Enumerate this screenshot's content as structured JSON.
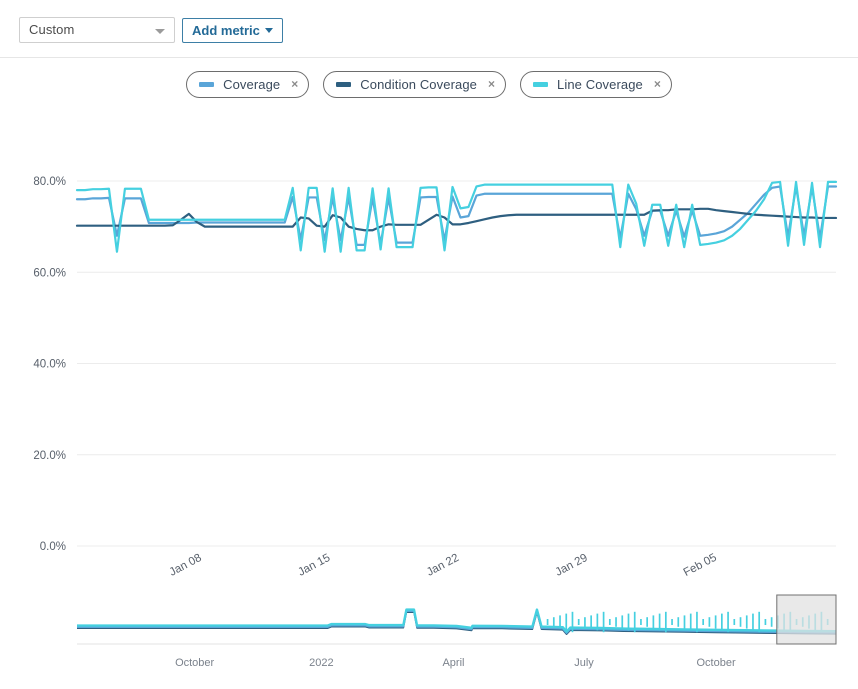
{
  "toolbar": {
    "period_select_value": "Custom",
    "add_metric_label": "Add metric"
  },
  "legend": {
    "items": [
      {
        "label": "Coverage",
        "color": "#5aa5d8",
        "close_label": "×"
      },
      {
        "label": "Condition Coverage",
        "color": "#2e5f80",
        "close_label": "×"
      },
      {
        "label": "Line Coverage",
        "color": "#45d0e0",
        "close_label": "×"
      }
    ]
  },
  "chart_data": {
    "type": "line",
    "title": "",
    "xlabel": "",
    "ylabel": "",
    "ylim": [
      0,
      85
    ],
    "yticks": [
      0,
      20,
      40,
      60,
      80
    ],
    "ytick_labels": [
      "0.0%",
      "20.0%",
      "40.0%",
      "60.0%",
      "80.0%"
    ],
    "grid": true,
    "legend_position": "top-center",
    "xtick_labels": [
      "Jan 08",
      "Jan 15",
      "Jan 22",
      "Jan 29",
      "Feb 05"
    ],
    "xtick_positions": [
      0.145,
      0.3145,
      0.484,
      0.6535,
      0.823
    ],
    "series": [
      {
        "name": "Coverage",
        "color": "#5aa5d8",
        "values": [
          76.0,
          76.0,
          76.2,
          76.2,
          76.3,
          68.0,
          76.2,
          76.2,
          76.2,
          70.8,
          70.8,
          70.8,
          70.8,
          70.8,
          70.8,
          70.9,
          70.9,
          70.9,
          70.9,
          70.9,
          70.9,
          70.9,
          70.9,
          70.9,
          70.9,
          70.9,
          70.9,
          76.5,
          67.2,
          76.4,
          76.4,
          67.0,
          76.3,
          67.0,
          76.4,
          66.0,
          66.0,
          76.3,
          66.2,
          76.3,
          66.5,
          66.5,
          66.5,
          76.4,
          76.5,
          76.5,
          67.0,
          76.6,
          72.0,
          72.3,
          76.8,
          77.2,
          77.2,
          77.2,
          77.2,
          77.2,
          77.2,
          77.2,
          77.2,
          77.2,
          77.2,
          77.2,
          77.2,
          77.2,
          77.2,
          77.2,
          77.2,
          77.2,
          67.5,
          77.2,
          73.8,
          68.0,
          73.5,
          73.5,
          68.0,
          73.5,
          67.8,
          73.5,
          68.0,
          68.2,
          68.5,
          69.0,
          70.0,
          71.5,
          73.0,
          75.0,
          77.0,
          78.5,
          78.8,
          67.8,
          78.8,
          68.0,
          78.6,
          67.5,
          78.8,
          78.8
        ]
      },
      {
        "name": "Condition Coverage",
        "color": "#2e5f80",
        "values": [
          70.2,
          70.2,
          70.2,
          70.2,
          70.2,
          70.2,
          70.2,
          70.2,
          70.2,
          70.2,
          70.2,
          70.2,
          70.3,
          71.5,
          72.8,
          71.0,
          70.0,
          70.0,
          70.0,
          70.0,
          70.0,
          70.0,
          70.0,
          70.0,
          70.0,
          70.0,
          70.0,
          70.0,
          72.0,
          71.8,
          70.2,
          70.0,
          72.5,
          72.0,
          70.0,
          69.5,
          69.2,
          69.2,
          70.0,
          70.5,
          70.4,
          70.4,
          70.4,
          70.4,
          71.5,
          72.6,
          72.0,
          70.5,
          70.5,
          70.8,
          71.2,
          71.6,
          72.0,
          72.3,
          72.5,
          72.6,
          72.6,
          72.6,
          72.6,
          72.6,
          72.6,
          72.6,
          72.6,
          72.6,
          72.6,
          72.6,
          72.6,
          72.6,
          72.6,
          72.6,
          72.6,
          72.6,
          73.5,
          73.6,
          73.6,
          73.8,
          73.8,
          73.8,
          73.9,
          73.9,
          73.6,
          73.4,
          73.2,
          73.0,
          72.8,
          72.6,
          72.5,
          72.4,
          72.3,
          72.2,
          72.1,
          72.0,
          72.0,
          71.9,
          71.9,
          71.9
        ]
      },
      {
        "name": "Line Coverage",
        "color": "#45d0e0",
        "values": [
          78.0,
          78.0,
          78.2,
          78.2,
          78.3,
          64.5,
          78.3,
          78.3,
          78.3,
          71.5,
          71.5,
          71.5,
          71.5,
          71.5,
          71.5,
          71.5,
          71.5,
          71.5,
          71.5,
          71.5,
          71.5,
          71.5,
          71.5,
          71.5,
          71.5,
          71.5,
          71.5,
          78.5,
          64.8,
          78.5,
          78.5,
          64.5,
          78.4,
          64.5,
          78.5,
          64.8,
          64.8,
          78.4,
          65.0,
          78.4,
          65.5,
          65.5,
          65.5,
          78.5,
          78.6,
          78.6,
          64.8,
          78.7,
          74.0,
          74.3,
          78.8,
          79.2,
          79.2,
          79.2,
          79.2,
          79.2,
          79.2,
          79.2,
          79.2,
          79.2,
          79.2,
          79.2,
          79.2,
          79.2,
          79.2,
          79.2,
          79.2,
          79.2,
          65.5,
          79.2,
          75.0,
          65.8,
          74.8,
          74.8,
          65.8,
          74.8,
          65.5,
          74.8,
          66.0,
          66.2,
          66.5,
          67.0,
          68.0,
          69.5,
          71.5,
          73.5,
          76.0,
          79.6,
          79.8,
          65.8,
          79.8,
          66.0,
          79.6,
          65.5,
          79.8,
          79.8
        ]
      }
    ],
    "navigator": {
      "tick_labels": [
        "October",
        "2022",
        "April",
        "July",
        "October"
      ],
      "tick_positions": [
        0.155,
        0.322,
        0.496,
        0.668,
        0.842
      ],
      "selection_start": 0.922,
      "selection_end": 1.0,
      "selection_fill": "#e2e2e2",
      "selection_border": "#707070"
    }
  }
}
